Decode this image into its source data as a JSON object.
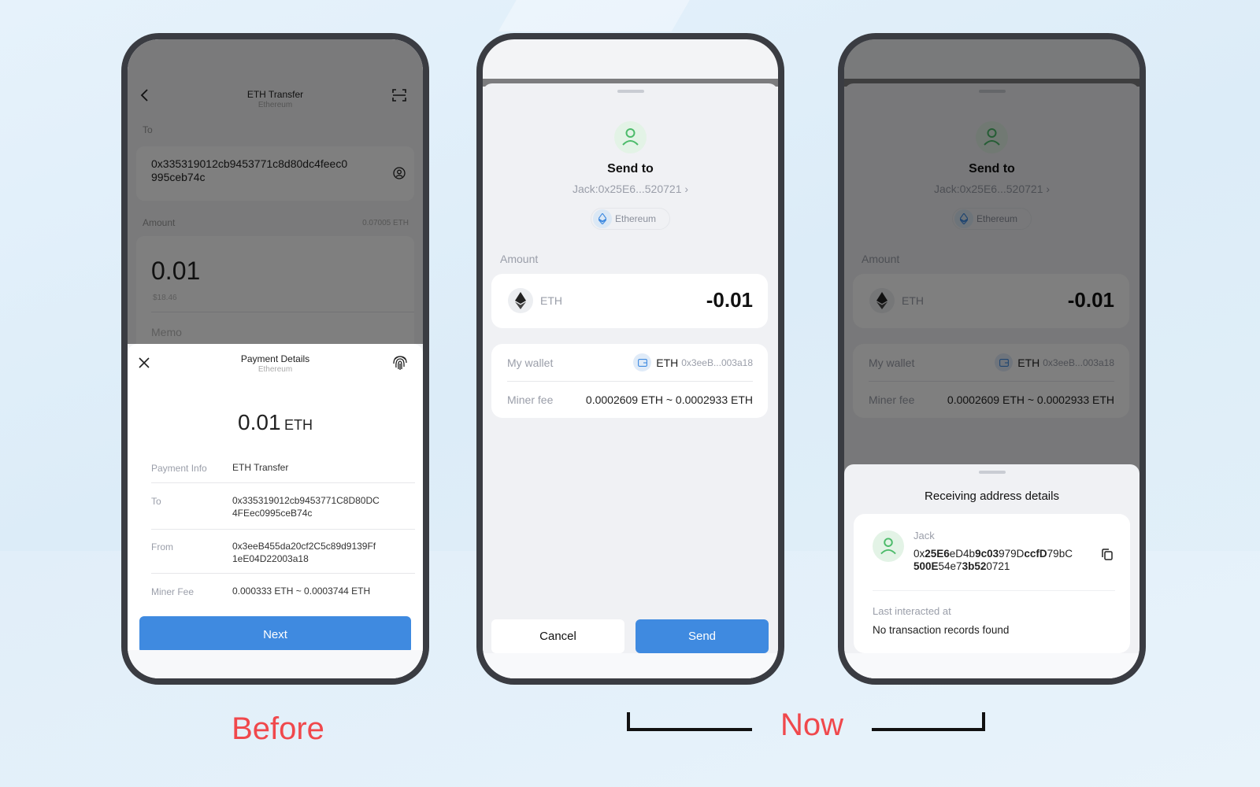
{
  "colors": {
    "accent": "#3f8ae0",
    "label_red": "#f0484c",
    "green": "#4cbb6a"
  },
  "before": {
    "header": {
      "title": "ETH Transfer",
      "subtitle": "Ethereum",
      "back_icon": "chevron-left-icon",
      "scan_icon": "scan-icon"
    },
    "to_label": "To",
    "to_address_line1": "0x335319012cb9453771c8d80dc4feec0",
    "to_address_line2": "995ceb74c",
    "amount_label": "Amount",
    "balance": "0.07005 ETH",
    "amount": "0.01",
    "amount_fiat": "$18.46",
    "memo_placeholder": "Memo",
    "sheet": {
      "title": "Payment Details",
      "subtitle": "Ethereum",
      "amount": "0.01",
      "unit": "ETH",
      "rows": [
        {
          "label": "Payment Info",
          "value": "ETH Transfer"
        },
        {
          "label": "To",
          "value": "0x335319012cb9453771C8D80DC",
          "value2": "4FEec0995ceB74c"
        },
        {
          "label": "From",
          "value": "0x3eeB455da20cf2C5c89d9139Ff",
          "value2": "1eE04D22003a18"
        },
        {
          "label": "Miner Fee",
          "value": "0.000333 ETH ~ 0.0003744 ETH"
        }
      ],
      "next_label": "Next"
    }
  },
  "now": {
    "send_to_title": "Send to",
    "recipient": "Jack:0x25E6...520721",
    "network": "Ethereum",
    "amount_label": "Amount",
    "token": "ETH",
    "amount": "-0.01",
    "my_wallet_label": "My wallet",
    "wallet_token": "ETH",
    "wallet_address": "0x3eeB...003a18",
    "miner_fee_label": "Miner fee",
    "miner_fee": "0.0002609 ETH ~ 0.0002933 ETH",
    "cancel_label": "Cancel",
    "send_label": "Send"
  },
  "details": {
    "title": "Receiving address details",
    "name": "Jack",
    "address_line1": [
      {
        "t": "0x",
        "b": false
      },
      {
        "t": "25E6",
        "b": true
      },
      {
        "t": "eD4b",
        "b": false
      },
      {
        "t": "9c03",
        "b": true
      },
      {
        "t": "979D",
        "b": false
      },
      {
        "t": "ccfD",
        "b": true
      },
      {
        "t": "79bC",
        "b": false
      }
    ],
    "address_line2": [
      {
        "t": "500E",
        "b": true
      },
      {
        "t": "54e7",
        "b": false
      },
      {
        "t": "3b52",
        "b": true
      },
      {
        "t": "0721",
        "b": false
      }
    ],
    "last_label": "Last interacted at",
    "last_value": "No transaction records found"
  },
  "captions": {
    "before": "Before",
    "now": "Now"
  }
}
